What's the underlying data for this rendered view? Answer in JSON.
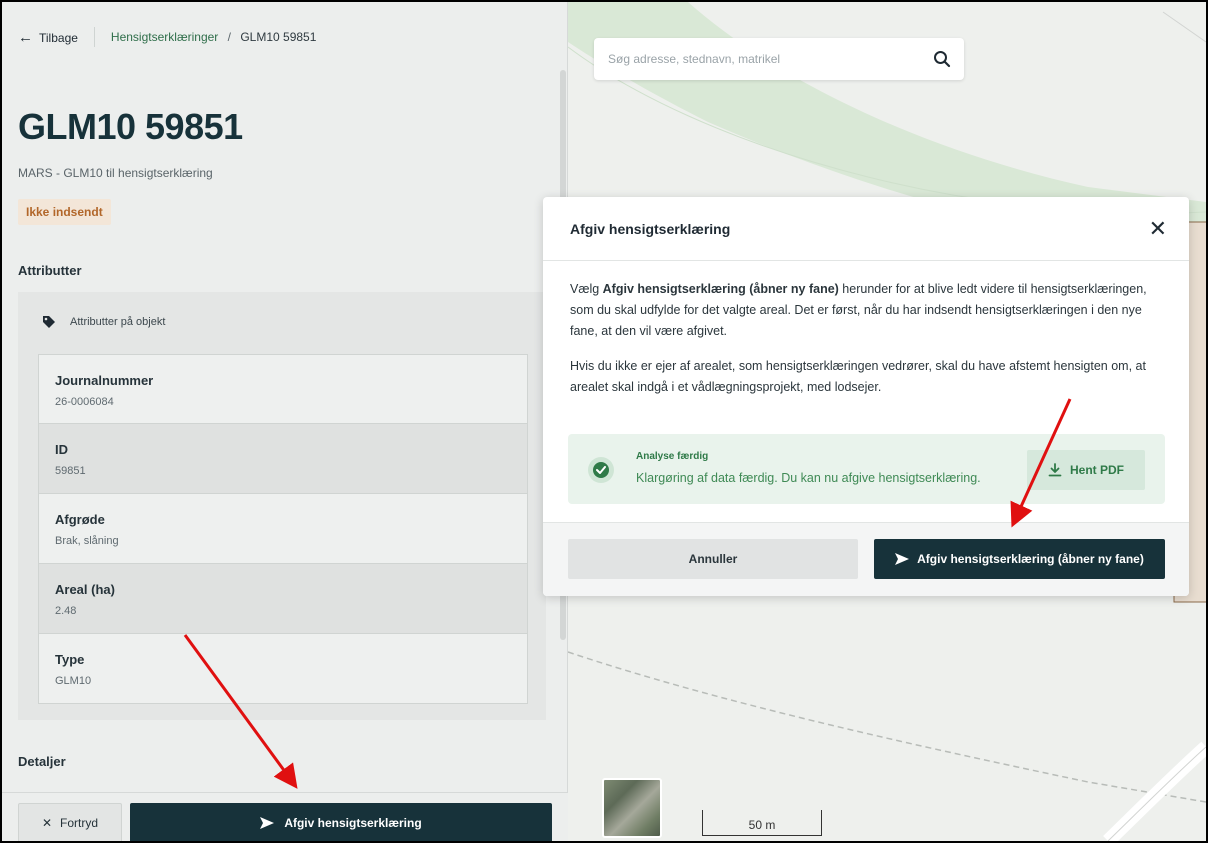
{
  "topbar": {
    "back_label": "Tilbage",
    "breadcrumb_link": "Hensigtserklæringer",
    "breadcrumb_sep": "/",
    "breadcrumb_current": "GLM10 59851"
  },
  "header": {
    "title": "GLM10 59851",
    "subtitle": "MARS - GLM10 til hensigtserklæring",
    "status_badge": "Ikke indsendt"
  },
  "attributes": {
    "section_title": "Attributter",
    "card_title": "Attributter på objekt",
    "rows": [
      {
        "label": "Journalnummer",
        "value": "26-0006084"
      },
      {
        "label": "ID",
        "value": "59851"
      },
      {
        "label": "Afgrøde",
        "value": "Brak, slåning"
      },
      {
        "label": "Areal (ha)",
        "value": "2.48"
      },
      {
        "label": "Type",
        "value": "GLM10"
      }
    ]
  },
  "details": {
    "section_title": "Detaljer"
  },
  "panel_actions": {
    "cancel_label": "Fortryd",
    "submit_label": "Afgiv hensigtserklæring"
  },
  "map": {
    "search_placeholder": "Søg adresse, stednavn, matrikel",
    "scale_label": "50 m"
  },
  "modal": {
    "title": "Afgiv hensigtserklæring",
    "p1_pre": "Vælg ",
    "p1_bold": "Afgiv hensigtserklæring (åbner ny fane)",
    "p1_post": " herunder for at blive ledt videre til hensigtserklæringen, som du skal udfylde for det valgte areal. Det er først, når du har indsendt hensigtserklæringen i den nye fane, at den vil være afgivet.",
    "p2": "Hvis du ikke er ejer af arealet, som hensigtserklæringen vedrører, skal du have afstemt hensigten om, at arealet skal indgå i et vådlægningsprojekt, med lodsejer.",
    "analysis_title": "Analyse færdig",
    "analysis_text": "Klargøring af data færdig. Du kan nu afgive hensigtserklæring.",
    "pdf_label": "Hent PDF",
    "cancel_label": "Annuller",
    "submit_label": "Afgiv hensigtserklæring (åbner ny fane)"
  },
  "colors": {
    "primary_dark": "#17323a",
    "success": "#2f7a48",
    "warning_text": "#b2672a",
    "annotation_arrow": "#e01010"
  }
}
